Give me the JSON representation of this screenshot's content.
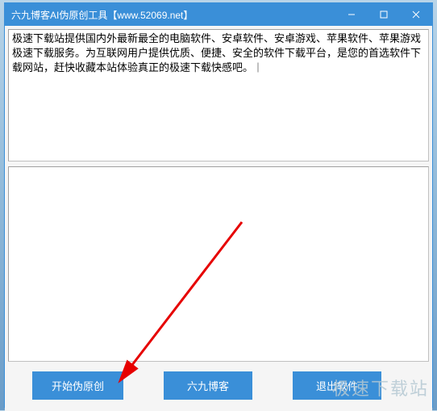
{
  "window": {
    "title": "六九博客AI伪原创工具【www.52069.net】"
  },
  "input": {
    "text": "极速下载站提供国内外最新最全的电脑软件、安卓软件、安卓游戏、苹果软件、苹果游戏极速下载服务。为互联网用户提供优质、便捷、安全的软件下载平台，是您的首选软件下载网站，赶快收藏本站体验真正的极速下载快感吧。"
  },
  "output": {
    "text": ""
  },
  "buttons": {
    "start": "开始伪原创",
    "blog": "六九博客",
    "exit": "退出软件"
  },
  "watermark": "极速下载站"
}
